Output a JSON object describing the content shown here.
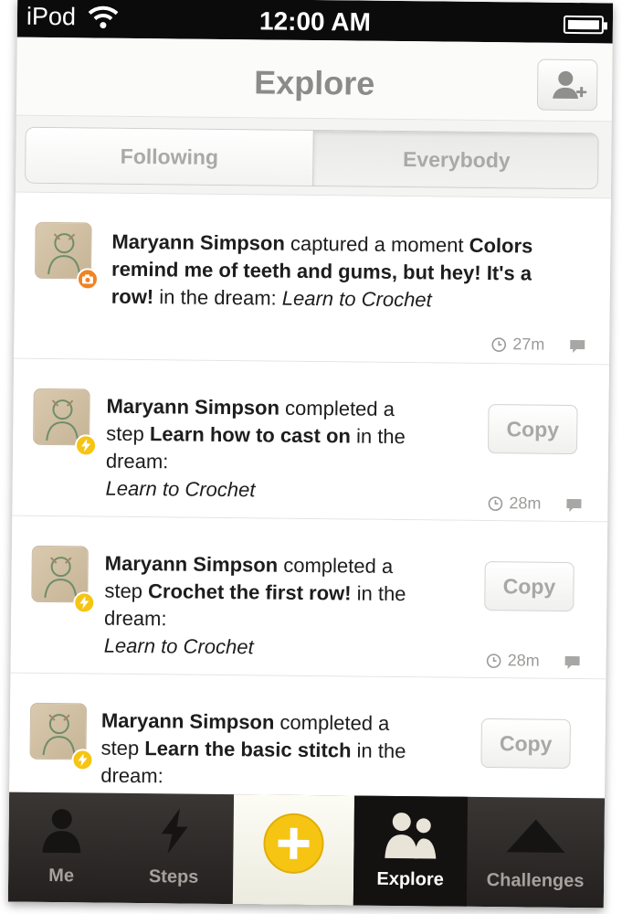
{
  "status_bar": {
    "carrier": "iPod",
    "time": "12:00 AM"
  },
  "nav": {
    "title": "Explore",
    "add_friend_icon": "add-person-icon"
  },
  "segments": {
    "following": "Following",
    "everybody": "Everybody",
    "selected": "Everybody"
  },
  "feed": {
    "items": [
      {
        "author": "Maryann Simpson",
        "verb": "captured a moment",
        "object": "Colors remind me of teeth and gums, but hey! It's a row!",
        "connector": "in the dream:",
        "dream": "Learn to Crochet",
        "time": "27m",
        "badge": "camera-icon",
        "lines": [
          {
            "author": "Maryann Simpson",
            "rest": " captured a moment ",
            "bold_tail": "Colors"
          },
          {
            "bold": "remind me of teeth and gums, but hey! It's a"
          },
          {
            "bold": "row!",
            "rest": " in the dream: ",
            "italic": "Learn to Crochet"
          }
        ]
      },
      {
        "author": "Maryann Simpson",
        "verb": "completed a step",
        "object": "Learn how to cast on",
        "connector": "in the dream:",
        "dream": "Learn to Crochet",
        "time": "28m",
        "copy": "Copy",
        "badge": "bolt-icon",
        "lines": [
          {
            "author": "Maryann Simpson",
            "rest": " completed a"
          },
          {
            "rest": "step ",
            "bold": "Learn how to cast on",
            "tail": " in the"
          },
          {
            "rest": "dream:"
          },
          {
            "italic": "Learn to Crochet"
          }
        ]
      },
      {
        "author": "Maryann Simpson",
        "verb": "completed a step",
        "object": "Crochet the first row!",
        "connector": "in the dream:",
        "dream": "Learn to Crochet",
        "time": "28m",
        "copy": "Copy",
        "badge": "bolt-icon",
        "lines": [
          {
            "author": "Maryann Simpson",
            "rest": " completed a"
          },
          {
            "rest": "step ",
            "bold": "Crochet the first row!",
            "tail": " in the"
          },
          {
            "rest": "dream:"
          },
          {
            "italic": "Learn to Crochet"
          }
        ]
      },
      {
        "author": "Maryann Simpson",
        "verb": "completed a step",
        "object": "Learn the basic stitch",
        "connector": "in the dream:",
        "copy": "Copy",
        "badge": "bolt-icon",
        "lines": [
          {
            "author": "Maryann Simpson",
            "rest": " completed a"
          },
          {
            "rest": "step ",
            "bold": "Learn the basic stitch",
            "tail": " in the"
          },
          {
            "rest": "dream:"
          }
        ]
      }
    ]
  },
  "tabbar": {
    "tabs": [
      {
        "label": "Me",
        "icon": "person-icon"
      },
      {
        "label": "Steps",
        "icon": "lightning-bolt-icon"
      },
      {
        "label": "",
        "icon": "plus-circle-icon"
      },
      {
        "label": "Explore",
        "icon": "people-icon"
      },
      {
        "label": "Challenges",
        "icon": "mountain-icon"
      }
    ],
    "active": "Explore"
  },
  "colors": {
    "accent_yellow": "#f6c513",
    "camera_orange": "#f08323",
    "tab_bar": "#2c2827",
    "nav_title": "#8b8b8b"
  }
}
